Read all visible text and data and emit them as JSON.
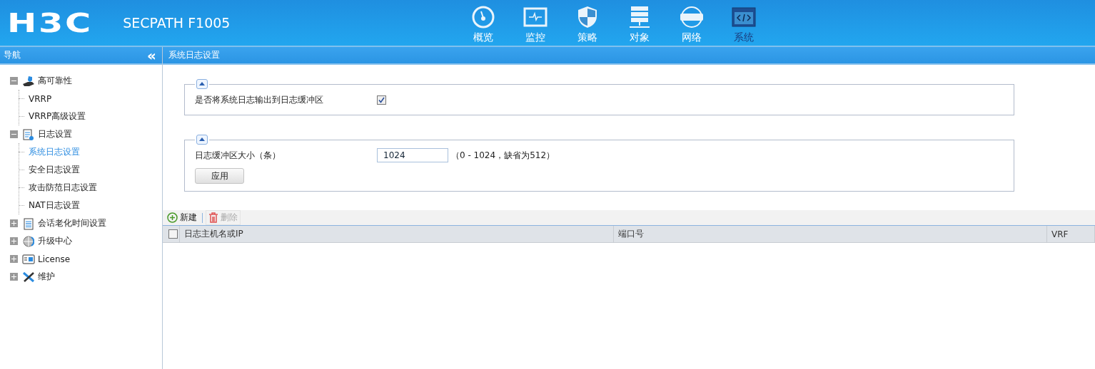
{
  "header": {
    "logo": "H3C",
    "product": "SECPATH F1005"
  },
  "nav": [
    {
      "label": "概览",
      "selected": false
    },
    {
      "label": "监控",
      "selected": false
    },
    {
      "label": "策略",
      "selected": false
    },
    {
      "label": "对象",
      "selected": false
    },
    {
      "label": "网络",
      "selected": false
    },
    {
      "label": "系统",
      "selected": true
    }
  ],
  "sidebar": {
    "title": "导航",
    "collapse": "«",
    "items": [
      {
        "label": "高可靠性",
        "expanded": true,
        "children": [
          {
            "label": "VRRP",
            "selected": false
          },
          {
            "label": "VRRP高级设置",
            "selected": false
          }
        ]
      },
      {
        "label": "日志设置",
        "expanded": true,
        "children": [
          {
            "label": "系统日志设置",
            "selected": true
          },
          {
            "label": "安全日志设置",
            "selected": false
          },
          {
            "label": "攻击防范日志设置",
            "selected": false
          },
          {
            "label": "NAT日志设置",
            "selected": false
          }
        ]
      },
      {
        "label": "会话老化时间设置",
        "expanded": false
      },
      {
        "label": "升级中心",
        "expanded": false
      },
      {
        "label": "License",
        "expanded": false
      },
      {
        "label": "维护",
        "expanded": false
      }
    ]
  },
  "page_title": "系统日志设置",
  "panels": [
    {
      "kind": "checkbox",
      "label": "是否将系统日志输出到日志缓冲区",
      "checked": true
    },
    {
      "kind": "input",
      "label": "日志缓冲区大小（条）",
      "value": "1024",
      "hint": "（0 - 1024，缺省为512）",
      "button": "应用"
    }
  ],
  "toolbar": [
    {
      "label": "新建",
      "disabled": false
    },
    {
      "label": "删除",
      "disabled": true
    }
  ],
  "table": {
    "select_all": false,
    "columns": [
      "日志主机名或IP",
      "端口号",
      "VRF"
    ]
  }
}
